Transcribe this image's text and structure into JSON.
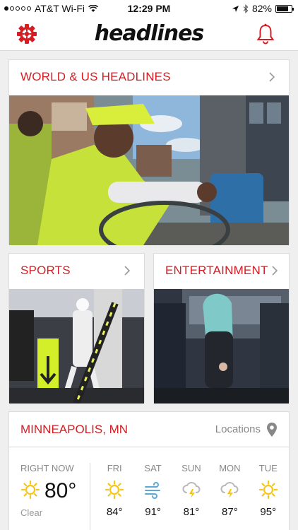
{
  "status_bar": {
    "carrier": "AT&T Wi-Fi",
    "time": "12:29 PM",
    "battery": "82%",
    "battery_level": 0.82
  },
  "header": {
    "logo": "headlines"
  },
  "sections": {
    "world": {
      "title": "WORLD & US HEADLINES"
    },
    "sports": {
      "title": "SPORTS"
    },
    "entertainment": {
      "title": "ENTERTAINMENT"
    }
  },
  "weather": {
    "city": "MINNEAPOLIS, MN",
    "locations_label": "Locations",
    "now": {
      "label": "RIGHT NOW",
      "temp": "80°",
      "condition": "Clear",
      "icon": "sun-icon"
    },
    "forecast": [
      {
        "day": "FRI",
        "temp": "84°",
        "icon": "sun-icon"
      },
      {
        "day": "SAT",
        "temp": "91°",
        "icon": "wind-icon"
      },
      {
        "day": "SUN",
        "temp": "81°",
        "icon": "storm-icon"
      },
      {
        "day": "MON",
        "temp": "87°",
        "icon": "storm-icon"
      },
      {
        "day": "TUE",
        "temp": "95°",
        "icon": "sun-icon"
      }
    ]
  },
  "colors": {
    "accent": "#d41e23",
    "sun": "#f5c518",
    "wind": "#5aa9d6",
    "bolt": "#f5c518"
  }
}
